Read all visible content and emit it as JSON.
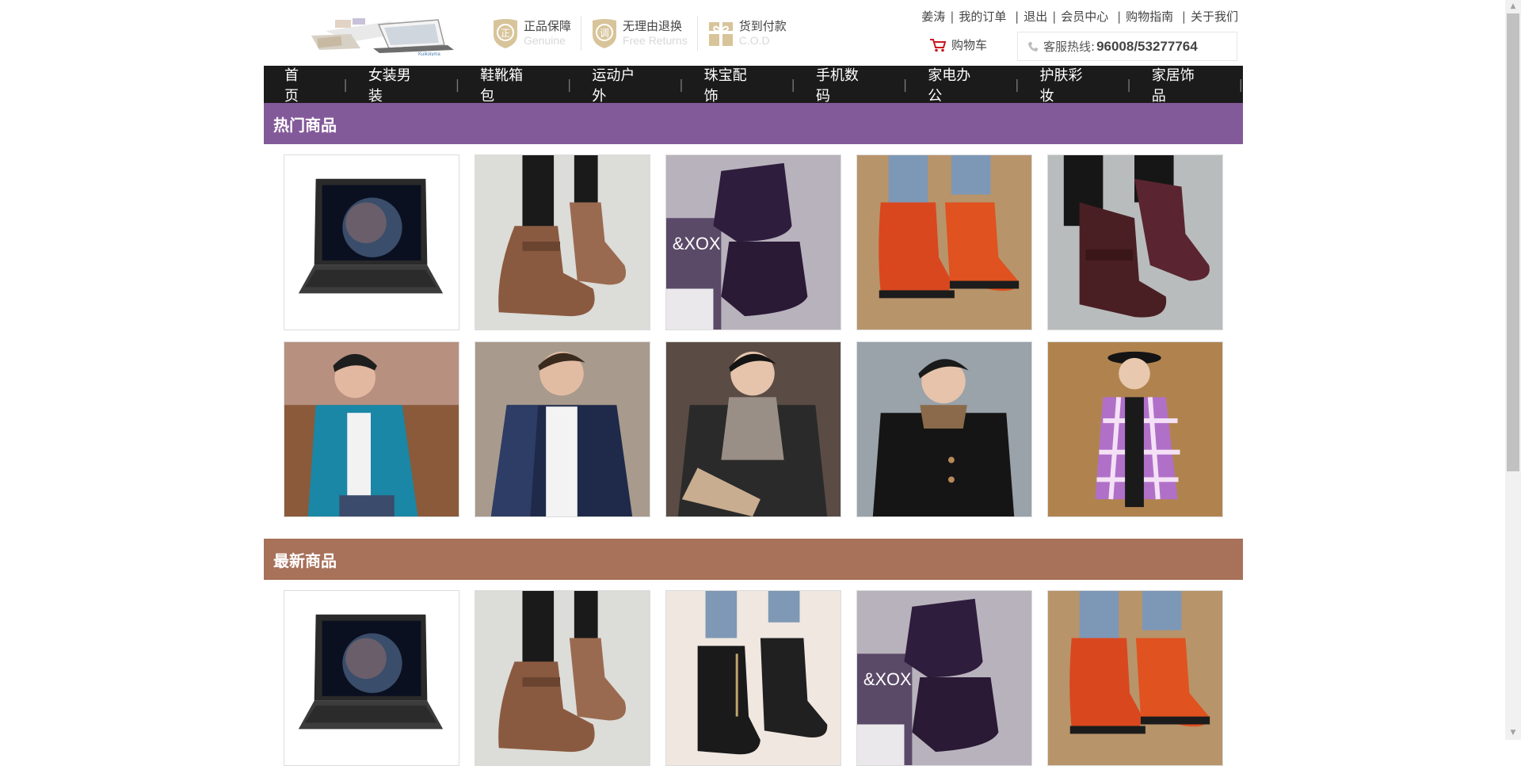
{
  "header": {
    "promises": [
      {
        "badge": "正",
        "title": "正品保障",
        "subtitle": "Genuine"
      },
      {
        "badge": "调",
        "title": "无理由退换",
        "subtitle": "Free Returns"
      },
      {
        "badge": "gift-icon",
        "title": "货到付款",
        "subtitle": "C.O.D"
      }
    ],
    "top_links": [
      "姜涛",
      "我的订单",
      "退出",
      "会员中心",
      "购物指南",
      "关于我们"
    ],
    "cart_label": "购物车",
    "hotline_label": "客服热线:",
    "hotline_number": "96008/53277764"
  },
  "nav": {
    "items": [
      "首页",
      "女装男装",
      "鞋靴箱包",
      "运动户外",
      "珠宝配饰",
      "手机数码",
      "家电办公",
      "护肤彩妆",
      "家居饰品"
    ]
  },
  "hot": {
    "title": "热门商品",
    "color": "#835a99",
    "products": [
      {
        "icon": "laptop"
      },
      {
        "icon": "brown-buckle-boot"
      },
      {
        "icon": "purple-suede-boots"
      },
      {
        "icon": "orange-suede-boot"
      },
      {
        "icon": "burgundy-buckle-boot"
      },
      {
        "icon": "teal-jacket-man"
      },
      {
        "icon": "navy-quilted-jacket-man"
      },
      {
        "icon": "scarf-leather-jacket-man"
      },
      {
        "icon": "black-hoodie-man"
      },
      {
        "icon": "plaid-coat-woman"
      }
    ]
  },
  "latest": {
    "title": "最新商品",
    "color": "#a8715a",
    "products": [
      {
        "icon": "laptop"
      },
      {
        "icon": "brown-buckle-boot"
      },
      {
        "icon": "black-ankle-boot"
      },
      {
        "icon": "purple-suede-boots"
      },
      {
        "icon": "orange-suede-boot"
      }
    ]
  }
}
